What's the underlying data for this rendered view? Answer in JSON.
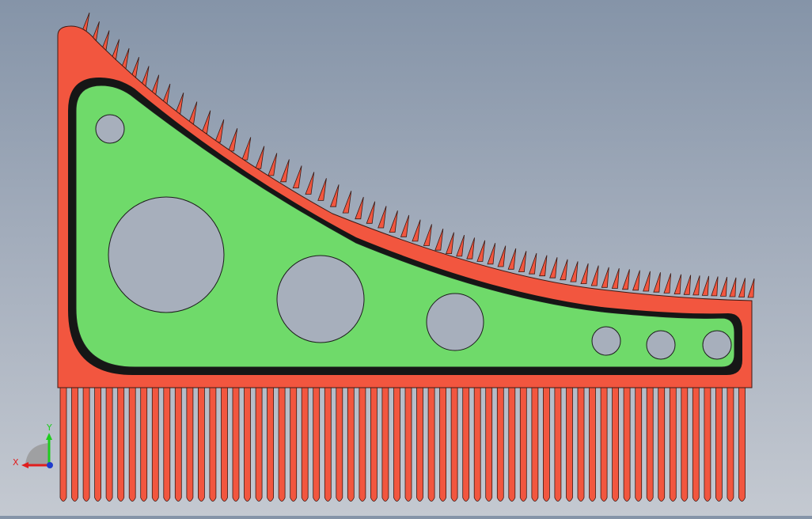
{
  "scene": {
    "background_top": "#8594a8",
    "background_bottom": "#c4c9d1",
    "body_color": "#f2563f",
    "body_edge_color": "#3c1a14",
    "face_color": "#6fda6a",
    "face_edge_color": "#1c1c1c",
    "hole_color": "#a7afbc",
    "tooth_count_bottom": 60,
    "tooth_count_top": 62
  },
  "triad": {
    "x_label": "X",
    "y_label": "Y",
    "x_color": "#e01e1e",
    "y_color": "#1ecc1e",
    "z_color": "#1e3ccc"
  }
}
